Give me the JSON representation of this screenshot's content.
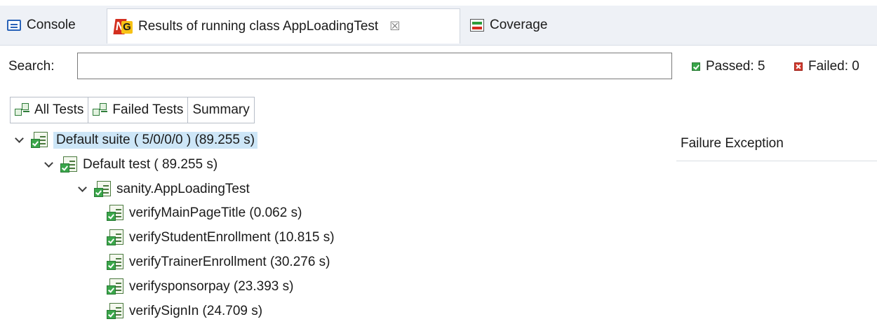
{
  "tabs": {
    "console": "Console",
    "results": "Results of running class AppLoadingTest",
    "results_close": "☒",
    "coverage": "Coverage"
  },
  "search": {
    "label": "Search:",
    "value": "",
    "placeholder": ""
  },
  "stats": {
    "passed": "Passed: 5",
    "failed": "Failed: 0"
  },
  "subtabs": {
    "all_tests": "All Tests",
    "failed_tests": "Failed Tests",
    "summary": "Summary"
  },
  "tree": {
    "suite": "Default suite ( 5/0/0/0 ) (89.255 s)",
    "test": "Default test ( 89.255 s)",
    "class": "sanity.AppLoadingTest",
    "methods": [
      "verifyMainPageTitle  (0.062 s)",
      "verifyStudentEnrollment  (10.815 s)",
      "verifyTrainerEnrollment  (30.276 s)",
      "verifysponsorpay  (23.393 s)",
      "verifySignIn  (24.709 s)"
    ]
  },
  "failure_panel": {
    "title": "Failure Exception"
  },
  "colors": {
    "pass": "#3aa64a",
    "fail": "#d23a2e",
    "selection": "#cde6f7",
    "tabbar": "#eef1f6"
  }
}
